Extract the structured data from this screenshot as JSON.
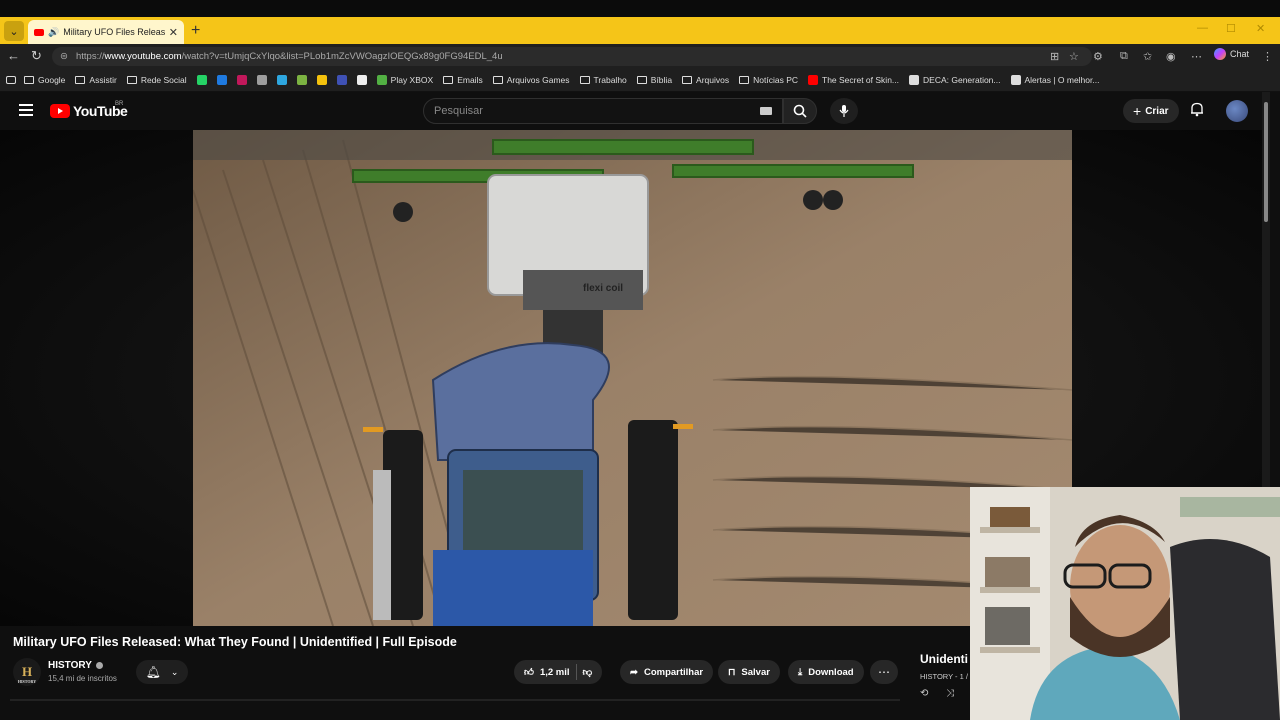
{
  "browser": {
    "tab_title": "Military UFO Files Released: W",
    "url_prefix": "https://",
    "url_host": "www.youtube.com",
    "url_path": "/watch?v=tUmjqCxYlqo&list=PLob1mZcVWOagzIOEQGx89g0FG94EDL_4u",
    "chat_label": "Chat",
    "bookmarks": [
      {
        "label": "Google",
        "kind": "folder"
      },
      {
        "label": "Assistir",
        "kind": "folder"
      },
      {
        "label": "Rede Social",
        "kind": "folder"
      },
      {
        "label": "",
        "kind": "icon",
        "color": "#25d366"
      },
      {
        "label": "",
        "kind": "icon",
        "color": "#1f7ae0"
      },
      {
        "label": "",
        "kind": "icon",
        "color": "#c2185b"
      },
      {
        "label": "",
        "kind": "icon",
        "color": "#9e9e9e"
      },
      {
        "label": "",
        "kind": "icon",
        "color": "#2ea7e0"
      },
      {
        "label": "",
        "kind": "icon",
        "color": "#7cb342"
      },
      {
        "label": "",
        "kind": "icon",
        "color": "#f4c20d"
      },
      {
        "label": "",
        "kind": "icon",
        "color": "#3f51b5"
      },
      {
        "label": "",
        "kind": "icon",
        "color": "#eeeeee"
      },
      {
        "label": "Play XBOX",
        "kind": "icon",
        "color": "#52b043"
      },
      {
        "label": "Emails",
        "kind": "folder"
      },
      {
        "label": "Arquivos Games",
        "kind": "folder"
      },
      {
        "label": "Trabalho",
        "kind": "folder"
      },
      {
        "label": "Bíblia",
        "kind": "folder"
      },
      {
        "label": "Arquivos",
        "kind": "folder"
      },
      {
        "label": "Notícias PC",
        "kind": "folder"
      },
      {
        "label": "The Secret of Skin...",
        "kind": "icon",
        "color": "#ff0000"
      },
      {
        "label": "DECA: Generation...",
        "kind": "icon",
        "color": "#dddddd"
      },
      {
        "label": "Alertas | O melhor...",
        "kind": "icon",
        "color": "#dddddd"
      }
    ]
  },
  "youtube": {
    "logo_text": "YouTube",
    "country": "BR",
    "search_placeholder": "Pesquisar",
    "create_label": "Criar"
  },
  "video": {
    "title": "Military UFO Files Released: What They Found | Unidentified | Full Episode",
    "overlay_text": "flexi coil",
    "channel_initial": "H",
    "channel_logo_text": "HISTORY",
    "channel_name": "HISTORY",
    "subscribers": "15,4 mi de inscritos",
    "likes": "1,2 mil",
    "share_label": "Compartilhar",
    "save_label": "Salvar",
    "download_label": "Download"
  },
  "playlist": {
    "title": "Unidenti",
    "subtitle": "HISTORY - 1 /"
  },
  "colors": {
    "accent_tabbar": "#f5c518",
    "youtube_red": "#ff0000",
    "background": "#0f0f0f"
  }
}
